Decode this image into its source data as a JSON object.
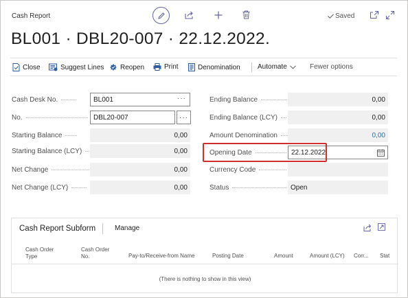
{
  "header": {
    "page_type": "Cash Report",
    "saved_label": "Saved",
    "title": "BL001 · DBL20-007 · 22.12.2022."
  },
  "actions": {
    "close": "Close",
    "suggest_lines": "Suggest Lines",
    "reopen": "Reopen",
    "print": "Print",
    "denomination": "Denomination",
    "automate": "Automate",
    "fewer_options": "Fewer options"
  },
  "left_fields": {
    "cash_desk_no": {
      "label": "Cash Desk No.",
      "value": "BL001"
    },
    "no": {
      "label": "No.",
      "value": "DBL20-007"
    },
    "starting_balance": {
      "label": "Starting Balance",
      "value": "0,00"
    },
    "starting_balance_lcy": {
      "label": "Starting Balance (LCY)",
      "value": "0,00"
    },
    "net_change": {
      "label": "Net Change",
      "value": "0,00"
    },
    "net_change_lcy": {
      "label": "Net Change (LCY)",
      "value": "0,00"
    }
  },
  "right_fields": {
    "ending_balance": {
      "label": "Ending Balance",
      "value": "0,00"
    },
    "ending_balance_lcy": {
      "label": "Ending Balance (LCY)",
      "value": "0,00"
    },
    "amount_denomination": {
      "label": "Amount Denomination",
      "value": "0,00"
    },
    "opening_date": {
      "label": "Opening Date",
      "value": "22.12.2022."
    },
    "currency_code": {
      "label": "Currency Code",
      "value": ""
    },
    "status": {
      "label": "Status",
      "value": "Open"
    }
  },
  "subform": {
    "title": "Cash Report Subform",
    "manage": "Manage",
    "columns": [
      "Cash Order Type",
      "Cash Order No.",
      "Pay-to/Receive-from Name",
      "Posting Date",
      "Amount",
      "Amount (LCY)",
      "Corr...",
      "Stat"
    ],
    "empty_message": "(There is nothing to show in this view)"
  },
  "colors": {
    "accent": "#6264a7",
    "highlight": "#d12f2f",
    "link_value": "#2f6f95"
  }
}
